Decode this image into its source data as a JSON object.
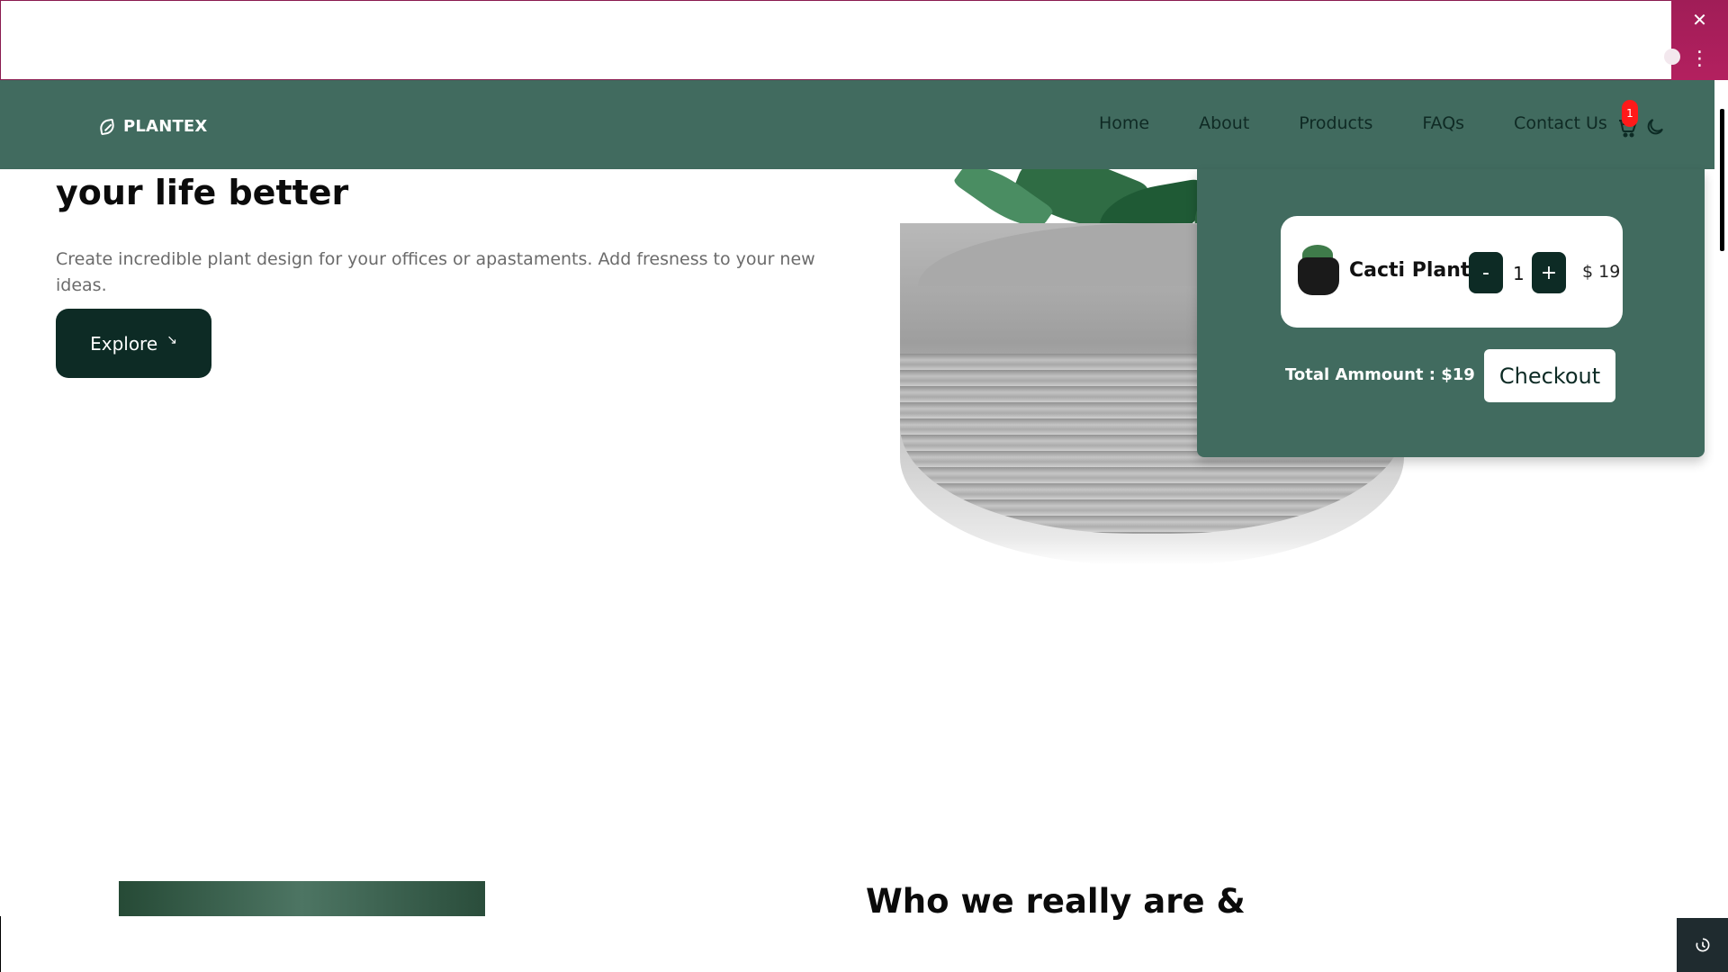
{
  "brand": {
    "name": "PLANTEX"
  },
  "nav": {
    "items": [
      "Home",
      "About",
      "Products",
      "FAQs",
      "Contact Us"
    ]
  },
  "cart": {
    "badge_count": "1"
  },
  "hero": {
    "title": "your life better",
    "description": "Create incredible plant design for your offices or apastaments. Add fresness to your new ideas.",
    "cta": "Explore"
  },
  "cart_panel": {
    "item": {
      "name": "Cacti Plant",
      "quantity": "1",
      "price": "$ 19",
      "minus": "-",
      "plus": "+"
    },
    "total": "Total Ammount : $19",
    "checkout": "Checkout"
  },
  "section": {
    "title": "Who we really are &"
  },
  "colors": {
    "nav_bg": "#416b5f",
    "button_dark": "#0d2b25",
    "badge": "#ff1a1a",
    "frame_accent": "#a01d57"
  },
  "icons": {
    "cart": "cart-icon",
    "theme": "moon-icon",
    "logo": "leaf-icon",
    "close": "close-icon",
    "menu": "more-vertical-icon"
  }
}
